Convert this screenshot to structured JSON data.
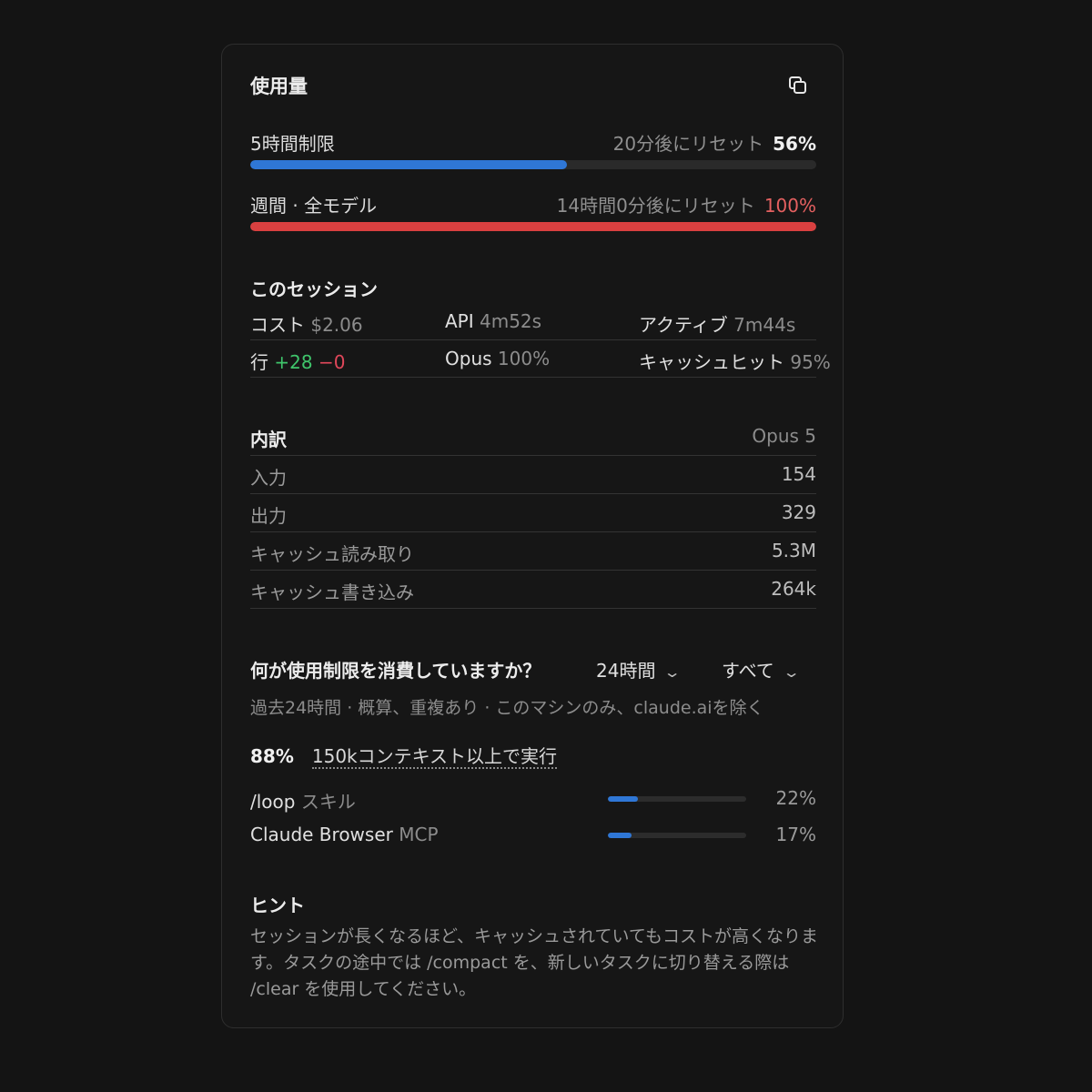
{
  "panel": {
    "title": "使用量",
    "copy_icon": "copy-icon"
  },
  "limits": [
    {
      "label": "5時間制限",
      "reset": "20分後にリセット",
      "percent": "56%",
      "fraction": 0.56,
      "bar_color": "#2f77d6"
    },
    {
      "label": "週間 · 全モデル",
      "reset": "14時間0分後にリセット",
      "percent": "100%",
      "fraction": 1.0,
      "bar_color": "#d94040"
    }
  ],
  "session": {
    "heading": "このセッション",
    "cost_label": "コスト",
    "cost_value": "$2.06",
    "api_label": "API",
    "api_value": "4m52s",
    "active_label": "アクティブ",
    "active_value": "7m44s",
    "lines_label": "行",
    "lines_added": "+28",
    "lines_removed": "−0",
    "opus_label": "Opus",
    "opus_value": "100%",
    "cache_label": "キャッシュヒット",
    "cache_value": "95%"
  },
  "breakdown": {
    "heading": "内訳",
    "model": "Opus 5",
    "rows": [
      {
        "label": "入力",
        "value": "154"
      },
      {
        "label": "出力",
        "value": "329"
      },
      {
        "label": "キャッシュ読み取り",
        "value": "5.3M"
      },
      {
        "label": "キャッシュ書き込み",
        "value": "264k"
      }
    ]
  },
  "consumption": {
    "question": "何が使用制限を消費していますか？",
    "range_select": "24時間",
    "scope_select": "すべて",
    "subtitle": "過去24時間 · 概算、重複あり · このマシンのみ、claude.aiを除く",
    "context_percent": "88%",
    "context_label": "150kコンテキスト以上で実行",
    "items": [
      {
        "name": "/loop",
        "kind": "スキル",
        "percent": "22%",
        "fraction": 0.22
      },
      {
        "name": "Claude Browser",
        "kind": "MCP",
        "percent": "17%",
        "fraction": 0.17
      }
    ]
  },
  "hint": {
    "heading": "ヒント",
    "text": "セッションが長くなるほど、キャッシュされていてもコストが高くなります。タスクの途中では /compact を、新しいタスクに切り替える際は /clear を使用してください。"
  }
}
